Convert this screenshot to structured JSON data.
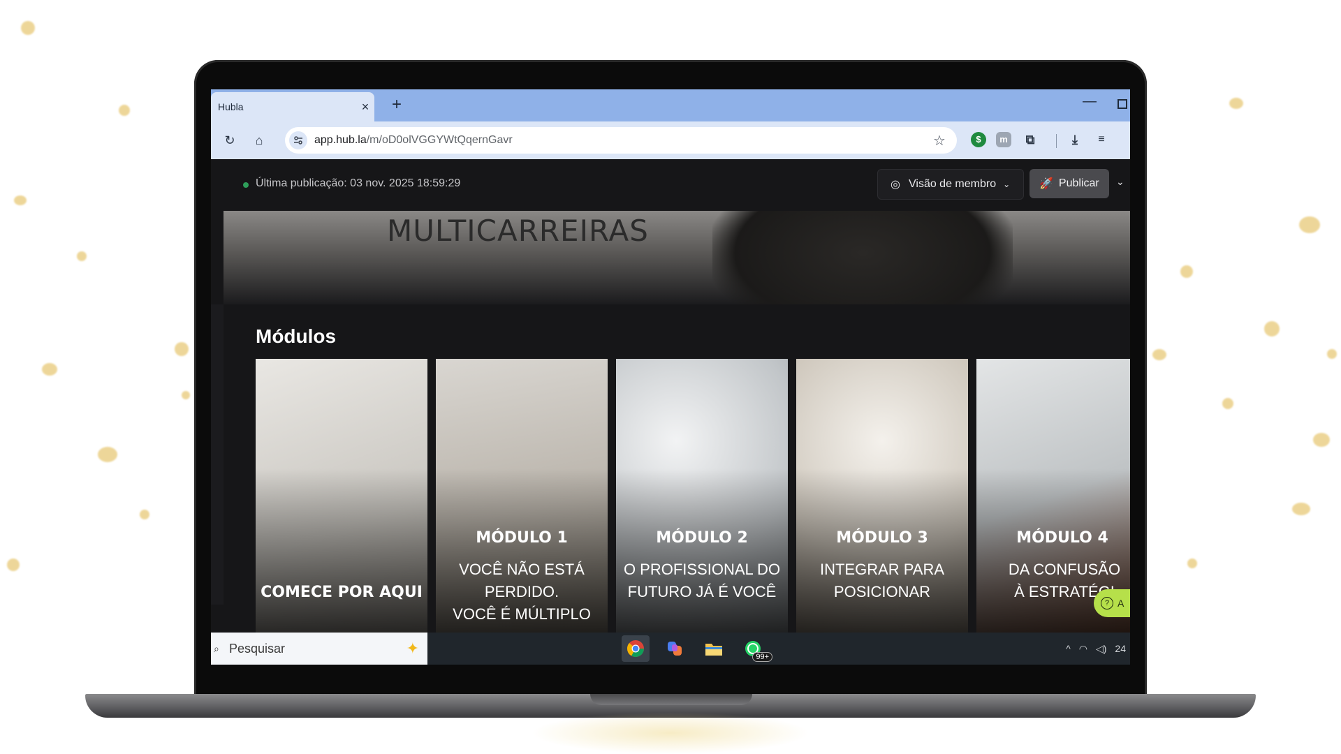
{
  "browser": {
    "tab_title": "Hubla",
    "tab_close_icon": "×",
    "new_tab_icon": "+",
    "minimize_icon": "—",
    "url_host": "app.hub.la",
    "url_path": "/m/oD0olVGGYWtQqernGavr",
    "star_icon": "☆",
    "ext_badge_text": "m"
  },
  "app": {
    "publish_status": "Última publicação: 03 nov. 2025 18:59:29",
    "member_view_label": "Visão de membro",
    "publish_label": "Publicar",
    "banner_title": "MULTICARREIRAS",
    "section_title": "Módulos",
    "cards": [
      {
        "label": "",
        "subtitle": "",
        "main": "COMECE POR AQUI",
        "bg": "#d8d6d2"
      },
      {
        "label": "MÓDULO 1",
        "subtitle": "VOCÊ NÃO ESTÁ\nPERDIDO.\nVOCÊ É MÚLTIPLO",
        "main": "",
        "bg": "#bdb8b1"
      },
      {
        "label": "MÓDULO 2",
        "subtitle": "O PROFISSIONAL DO\nFUTURO JÁ É VOCÊ",
        "main": "",
        "bg": "#c9cbcc"
      },
      {
        "label": "MÓDULO 3",
        "subtitle": "INTEGRAR PARA\nPOSICIONAR",
        "main": "",
        "bg": "#d2cdc6"
      },
      {
        "label": "MÓDULO 4",
        "subtitle": "DA CONFUSÃO\nÀ ESTRATÉGI",
        "main": "",
        "bg": "#cfd2d4"
      }
    ],
    "help_label": "A"
  },
  "taskbar": {
    "search_label": "Pesquisar",
    "whatsapp_badge": "99+",
    "clock_partial": "24"
  },
  "colors": {
    "confetti": "#e8c977",
    "help_bubble": "#b6e04a",
    "publish_dot": "#2e9e5a"
  }
}
